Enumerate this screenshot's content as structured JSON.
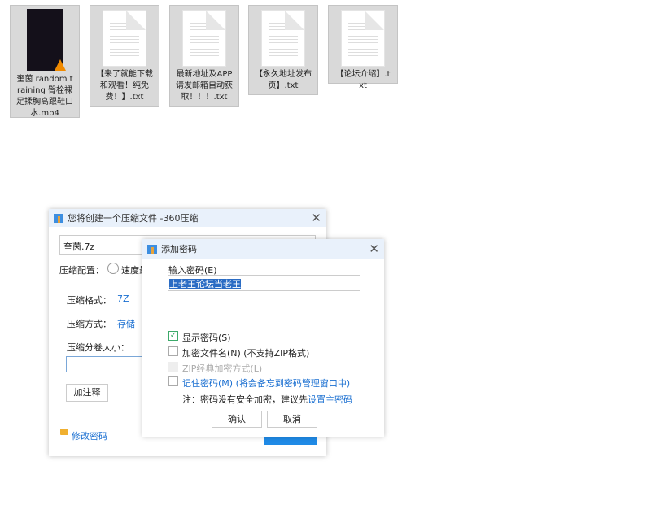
{
  "files": [
    {
      "name": "奎茵 random training 臀栓裸足揉胸高跟鞋口水.mp4",
      "type": "video"
    },
    {
      "name": "【来了就能下载和观看！纯免费！】.txt",
      "type": "text"
    },
    {
      "name": "最新地址及APP请发邮箱自动获取！！！.txt",
      "type": "text"
    },
    {
      "name": "【永久地址发布页】.txt",
      "type": "text"
    },
    {
      "name": "【论坛介绍】.txt",
      "type": "text"
    }
  ],
  "back_dialog": {
    "title": "您将创建一个压缩文件 -360压缩",
    "filename": "奎茵.7z",
    "config_label": "压缩配置：",
    "config_option": "速度最",
    "format_label": "压缩格式：",
    "format_value": "7Z",
    "method_label": "压缩方式：",
    "method_value": "存储",
    "split_label": "压缩分卷大小：",
    "comment_button": "加注释",
    "change_password": "修改密码"
  },
  "password_dialog": {
    "title": "添加密码",
    "input_label": "输入密码(E)",
    "password": "上老王论坛当老王",
    "show_password": {
      "label": "显示密码(S)",
      "checked": true
    },
    "encrypt_names": {
      "label": "加密文件名(N) (不支持ZIP格式)",
      "checked": false
    },
    "zip_classic": {
      "label": "ZIP经典加密方式(L)",
      "checked": false,
      "disabled": true
    },
    "remember": {
      "label": "记住密码(M) (将会备忘到密码管理窗口中)",
      "checked": false
    },
    "note": "注：密码没有安全加密，建议先",
    "note_link": "设置主密码",
    "ok": "确认",
    "cancel": "取消"
  }
}
